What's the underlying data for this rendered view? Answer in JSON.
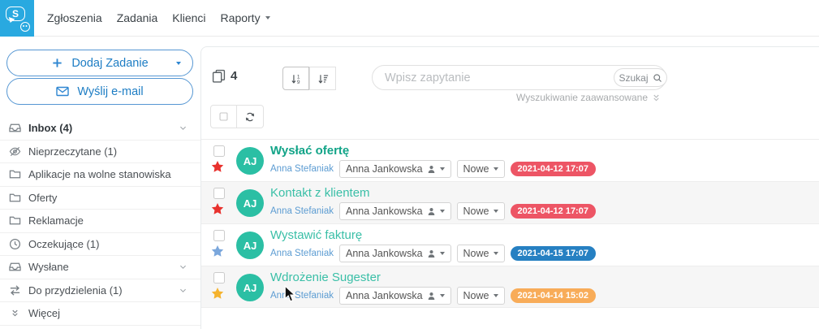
{
  "navbar": {
    "logo_letter": "S",
    "items": [
      {
        "label": "Zgłoszenia",
        "has_caret": false
      },
      {
        "label": "Zadania",
        "has_caret": false
      },
      {
        "label": "Klienci",
        "has_caret": false
      },
      {
        "label": "Raporty",
        "has_caret": true
      }
    ]
  },
  "sidebar": {
    "add_task": {
      "label": "Dodaj Zadanie",
      "icon": "plus-icon"
    },
    "send_email": {
      "label": "Wyślij e-mail",
      "icon": "envelope-icon"
    },
    "items": [
      {
        "label": "Inbox (4)",
        "icon": "inbox-icon",
        "bold": true,
        "chevron": true
      },
      {
        "label": "Nieprzeczytane (1)",
        "icon": "eye-slash-icon",
        "bold": false,
        "chevron": false
      },
      {
        "label": "Aplikacje na wolne stanowiska",
        "icon": "folder-icon",
        "bold": false,
        "chevron": false
      },
      {
        "label": "Oferty",
        "icon": "folder-icon",
        "bold": false,
        "chevron": false
      },
      {
        "label": "Reklamacje",
        "icon": "folder-icon",
        "bold": false,
        "chevron": false
      },
      {
        "label": "Oczekujące (1)",
        "icon": "clock-icon",
        "bold": false,
        "chevron": false
      },
      {
        "label": "Wysłane",
        "icon": "inbox-icon",
        "bold": false,
        "chevron": true
      },
      {
        "label": "Do przydzielenia (1)",
        "icon": "transfer-icon",
        "bold": false,
        "chevron": true
      },
      {
        "label": "Więcej",
        "icon": "double-chevron-down-icon",
        "bold": false,
        "chevron": false
      }
    ]
  },
  "toolbar": {
    "count": "4",
    "count_icon": "copy-icon",
    "sort_buttons": [
      {
        "icon": "sort-numeric-asc-icon",
        "active": true
      },
      {
        "icon": "sort-amount-desc-icon",
        "active": false
      }
    ],
    "select_icon": "checkbox-icon",
    "refresh_icon": "refresh-icon",
    "search": {
      "placeholder": "Wpisz zapytanie",
      "button_label": "Szukaj",
      "button_icon": "magnifier-icon",
      "advanced_label": "Wyszukiwanie zaawansowane",
      "advanced_icon": "double-chevron-down-icon"
    }
  },
  "tasks": [
    {
      "avatar": "AJ",
      "title": "Wysłać ofertę",
      "unread": true,
      "star_color": "#e8322e",
      "from": "Anna Stefaniak",
      "assignee": "Anna Jankowska",
      "assignee_icon": "person-icon",
      "status": "Nowe",
      "date": "2021-04-12 17:07",
      "badge_color": "#ed5565"
    },
    {
      "avatar": "AJ",
      "title": "Kontakt z klientem",
      "unread": false,
      "star_color": "#e8322e",
      "from": "Anna Stefaniak",
      "assignee": "Anna Jankowska",
      "assignee_icon": "person-icon",
      "status": "Nowe",
      "date": "2021-04-12 17:07",
      "badge_color": "#ed5565"
    },
    {
      "avatar": "AJ",
      "title": "Wystawić fakturę",
      "unread": false,
      "star_color": "#7ba7dc",
      "from": "Anna Stefaniak",
      "assignee": "Anna Jankowska",
      "assignee_icon": "person-icon",
      "status": "Nowe",
      "date": "2021-04-15 17:07",
      "badge_color": "#2680c2"
    },
    {
      "avatar": "AJ",
      "title": "Wdrożenie Sugester",
      "unread": false,
      "star_color": "#f5b32e",
      "from": "Anna Stefaniak",
      "assignee": "Anna Jankowska",
      "assignee_icon": "person-icon",
      "status": "Nowe",
      "date": "2021-04-14 15:02",
      "badge_color": "#f8ac59"
    }
  ],
  "colors": {
    "logo_bg": "#29a9e0",
    "accent_blue": "#1d7dc4",
    "teal": "#2bbfa4",
    "title_unread": "#12a488",
    "title_read": "#3abfa7",
    "link_blue": "#5c9cd2",
    "badge_red": "#ed5565",
    "badge_blue": "#2680c2",
    "badge_orange": "#f8ac59"
  }
}
